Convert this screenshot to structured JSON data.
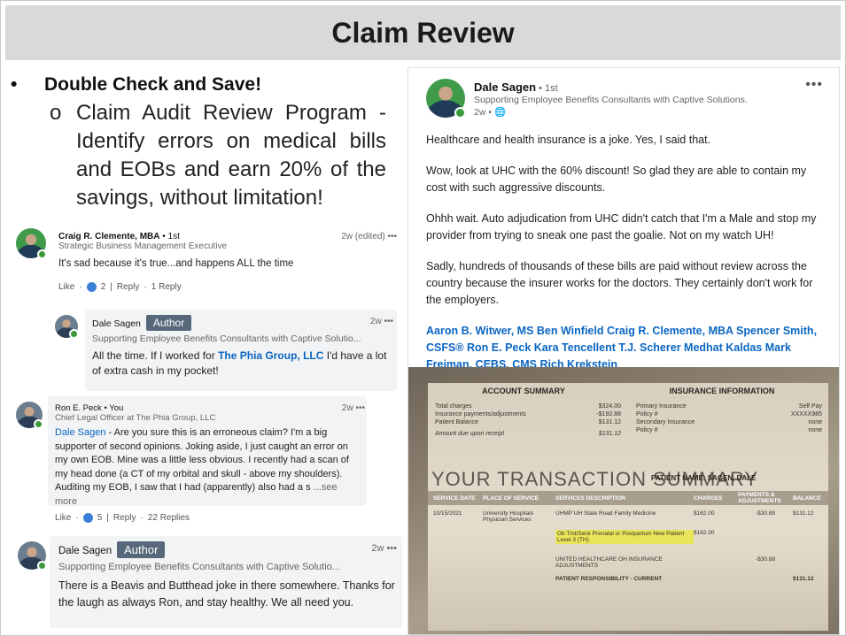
{
  "slide": {
    "title": "Claim Review"
  },
  "bullets": {
    "main": "Double Check and Save!",
    "sub_marker": "o",
    "sub": "Claim Audit Review Program - Identify errors on medical bills and EOBs and earn 20% of the savings, without limitation!"
  },
  "comments": [
    {
      "name": "Craig R. Clemente, MBA",
      "degree": " • 1st",
      "headline": "Strategic Business Management Executive",
      "time": "2w (edited) •••",
      "body": "It's sad because it's true...and happens ALL the time",
      "like": "Like",
      "count": "2",
      "reply": "Reply",
      "replies": "1 Reply"
    },
    {
      "name": "Dale Sagen",
      "badge": "Author",
      "headline": "Supporting Employee Benefits Consultants with Captive Solutio...",
      "time": "2w •••",
      "body_pre": "All the time. If I worked for ",
      "body_link": "The Phia Group, LLC",
      "body_post": " I'd have a lot of extra cash in my pocket!"
    },
    {
      "name": "Ron E. Peck",
      "degree": " • You",
      "headline": "Chief Legal Officer at The Phia Group, LLC",
      "time": "2w •••",
      "body_link": "Dale Sagen",
      "body_post": " - Are you sure this is an erroneous claim? I'm a big supporter of second opinions. Joking aside, I just caught an error on my own EOB. Mine was a little less obvious. I recently had a scan of my head done (a CT of my orbital and skull - above my shoulders). Auditing my EOB, I saw that I had (apparently) also had a s",
      "see_more": "...see more",
      "like": "Like",
      "count": "5",
      "reply": "Reply",
      "replies": "22 Replies"
    },
    {
      "name": "Dale Sagen",
      "badge": "Author",
      "headline": "Supporting Employee Benefits Consultants with Captive Solutio...",
      "time": "2w •••",
      "body": "There is a Beavis and Butthead joke in there somewhere. Thanks for the laugh as always Ron, and stay healthy. We all need you."
    }
  ],
  "post": {
    "name": "Dale Sagen",
    "degree": " • 1st",
    "headline": "Supporting Employee Benefits Consultants with Captive Solutions.",
    "time": "2w • ",
    "more": "•••",
    "p1": "Healthcare and health insurance is a joke. Yes, I said that.",
    "p2": "Wow, look at UHC with the 60% discount! So glad they are able to contain my cost with such aggressive discounts.",
    "p3": "Ohhh wait. Auto adjudication from UHC didn't catch that I'm a Male and stop my provider from trying to sneak one past the goalie. Not on my watch UH!",
    "p4": "Sadly, hundreds of thousands of these bills are paid without review across the country because the insurer works for the doctors. They certainly don't work for the employers.",
    "tags": "Aaron B. Witwer, MS Ben Winfield Craig R. Clemente, MBA Spencer Smith, CSFS® Ron E. Peck Kara Tencellent T.J. Scherer Medhat Kaldas Mark Freiman, CEBS, CMS Rich Krekstein"
  },
  "statement": {
    "account_summary": "ACCOUNT SUMMARY",
    "insurance_info": "INSURANCE INFORMATION",
    "acct_rows": [
      {
        "label": "Total charges",
        "value": "$324.00"
      },
      {
        "label": "Insurance payments/adjustments",
        "value": "-$192.88"
      },
      {
        "label": "Patient Balance",
        "value": "$131.12"
      },
      {
        "label": "Amount due upon receipt",
        "value": "$131.12"
      }
    ],
    "ins_rows": [
      {
        "label": "Primary Insurance",
        "value": "Self Pay"
      },
      {
        "label": "Policy #",
        "value": "XXXXX985"
      },
      {
        "label": "Secondary Insurance",
        "value": "none"
      },
      {
        "label": "Policy #",
        "value": "none"
      }
    ],
    "tx_title": "YOUR TRANSACTION SUMMARY",
    "patient": "PATIENT NAME: SAGEN, DALE",
    "cols": [
      "SERVICE DATE",
      "PLACE OF SERVICE",
      "SERVICES DESCRIPTION",
      "CHARGES",
      "PAYMENTS & ADJUSTMENTS",
      "BALANCE"
    ],
    "row1": {
      "date": "10/15/2021",
      "place": "University Hospitals Physician Services",
      "desc": "UHMP UH State Road Family Medicine",
      "charge": "$162.00",
      "adj": "-$30.88",
      "bal": "$131.12"
    },
    "row2": {
      "desc": "Ob Tmt/Seck Prenatal or Postpartum New Patient Level 3 (TH)",
      "charge": "$162.00"
    },
    "row3": {
      "desc": "UNITED HEALTHCARE OH INSURANCE ADJUSTMENTS",
      "adj": "-$30.88"
    },
    "row4": {
      "desc": "PATIENT RESPONSIBILITY - CURRENT",
      "bal": "$131.12"
    }
  }
}
